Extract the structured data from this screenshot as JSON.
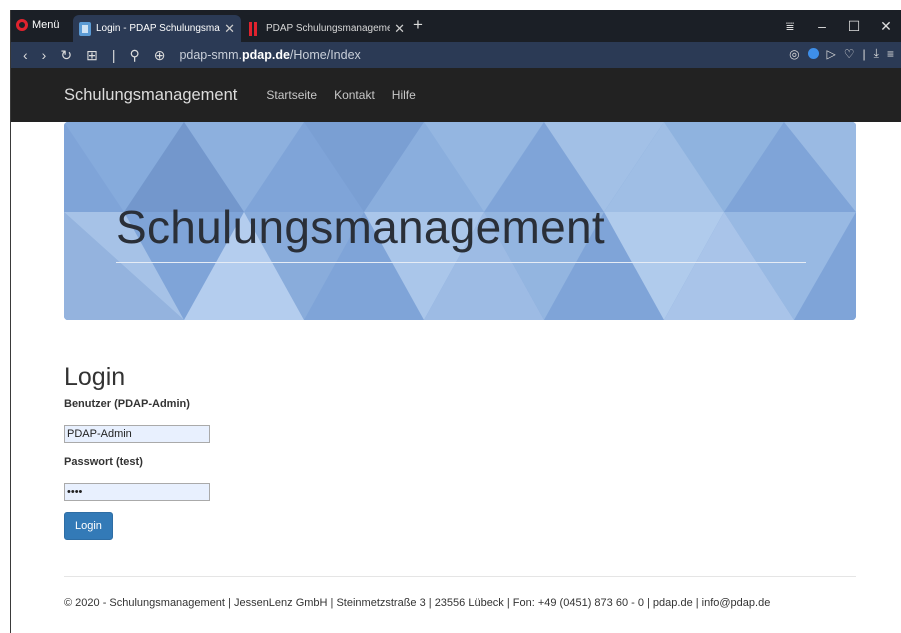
{
  "browser": {
    "menu_label": "Menü",
    "tabs": [
      {
        "title": "Login - PDAP Schulungsma",
        "active": true
      },
      {
        "title": "PDAP Schulungsmanageme",
        "active": false
      }
    ],
    "new_tab": "+",
    "url_host_prefix": "pdap-smm.",
    "url_host_domain": "pdap.de",
    "url_path": "/Home/Index",
    "window_controls": [
      "minimize",
      "maximize",
      "close"
    ]
  },
  "site": {
    "brand": "Schulungsmanagement",
    "nav": [
      "Startseite",
      "Kontakt",
      "Hilfe"
    ],
    "jumbotron_title": "Schulungsmanagement"
  },
  "login": {
    "heading": "Login",
    "user_label": "Benutzer (PDAP-Admin)",
    "user_value": "PDAP-Admin",
    "password_label": "Passwort (test)",
    "password_value": "test",
    "button": "Login"
  },
  "footer": {
    "text": "© 2020 - Schulungsmanagement | JessenLenz GmbH | Steinmetzstraße 3 | 23556 Lübeck | Fon: +49 (0451) 873 60 - 0 | pdap.de | info@pdap.de"
  },
  "colors": {
    "browser_dark": "#1b1f26",
    "tab_active": "#2b3a55",
    "navbar": "#222222",
    "jumbotron": "#7da2d6",
    "primary_button": "#337ab7",
    "opera_red": "#e0232e"
  }
}
